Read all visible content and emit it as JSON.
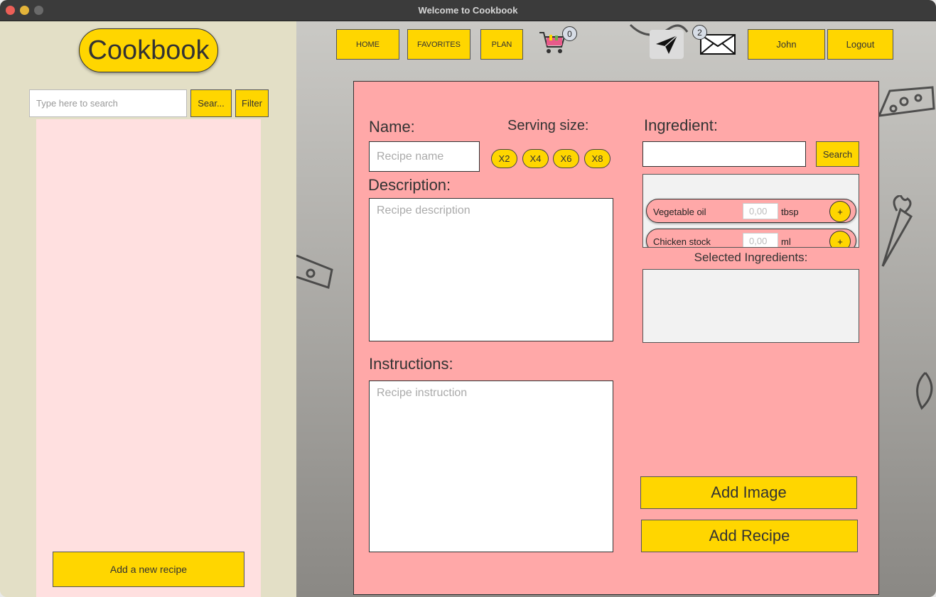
{
  "window": {
    "title": "Welcome to Cookbook"
  },
  "sidebar": {
    "logo": "Cookbook",
    "search_placeholder": "Type here to search",
    "search_button": "Sear...",
    "filter_button": "Filter",
    "add_new_recipe": "Add a new recipe"
  },
  "nav": {
    "home": "HOME",
    "favorites": "FAVORITES",
    "plan": "PLAN",
    "cart_count": "0",
    "message_count": "2",
    "user": "John",
    "logout": "Logout"
  },
  "form": {
    "name_label": "Name:",
    "name_placeholder": "Recipe name",
    "serving_label": "Serving size:",
    "serving_options": [
      "X2",
      "X4",
      "X6",
      "X8"
    ],
    "description_label": "Description:",
    "description_placeholder": "Recipe description",
    "instructions_label": "Instructions:",
    "instructions_placeholder": "Recipe instruction",
    "ingredient_label": "Ingredient:",
    "ingredient_search": "Search",
    "ingredients": [
      {
        "name": "Vegetable oil",
        "qty_placeholder": "0,00",
        "unit": "tbsp",
        "add": "+"
      },
      {
        "name": "Chicken stock",
        "qty_placeholder": "0,00",
        "unit": "ml",
        "add": "+"
      }
    ],
    "selected_label": "Selected Ingredients:",
    "add_image": "Add Image",
    "add_recipe": "Add Recipe"
  },
  "colors": {
    "accent_yellow": "#ffd600",
    "card_pink": "#ffa8a8",
    "sidebar_bg": "#e3dfc6",
    "list_pink": "#ffe0e0"
  },
  "icons": [
    "cart-icon",
    "paper-plane-icon",
    "envelope-icon"
  ]
}
